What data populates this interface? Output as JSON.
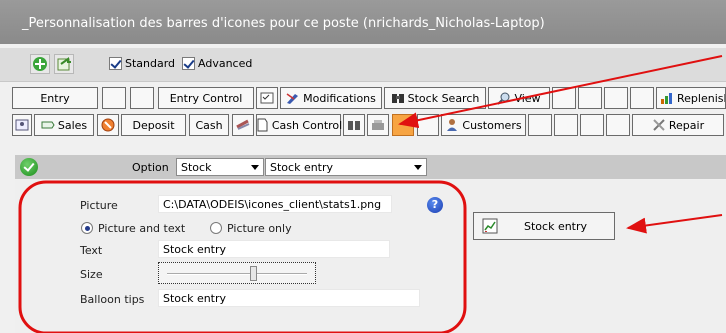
{
  "window": {
    "title": "_Personnalisation des barres d'icones pour ce poste (nrichards_Nicholas-Laptop)"
  },
  "topbar": {
    "checkboxes": [
      {
        "label": "Standard",
        "checked": true
      },
      {
        "label": "Advanced",
        "checked": true
      }
    ]
  },
  "toolbar_row1": {
    "entry": "Entry",
    "entry_control": "Entry Control",
    "modifications": "Modifications",
    "stock_search": "Stock Search",
    "view": "View",
    "replenish": "Replenish"
  },
  "toolbar_row2": {
    "sales": "Sales",
    "deposit": "Deposit",
    "cash": "Cash",
    "cash_control": "Cash Control",
    "customers": "Customers",
    "repair": "Repair"
  },
  "option": {
    "label": "Option",
    "category": "Stock",
    "action": "Stock entry"
  },
  "form": {
    "picture_label": "Picture",
    "picture_value": "C:\\DATA\\ODEIS\\icones_client\\stats1.png",
    "radio_text": "Picture and text",
    "radio_picture": "Picture only",
    "text_label": "Text",
    "text_value": "Stock entry",
    "size_label": "Size",
    "size_level_percent": 62,
    "balloon_label": "Balloon tips",
    "balloon_value": "Stock entry",
    "help_glyph": "?"
  },
  "preview": {
    "label": "Stock entry"
  },
  "colors": {
    "titlebar": "#8f8f8f",
    "highlight_button": "#f7a442",
    "annotation_red": "#e01010",
    "toolbar_border": "#6b6b6b"
  },
  "icons": [
    "add-icon",
    "export-icon",
    "sales-icon",
    "deposit-icon",
    "cash-icon",
    "binoculars-icon",
    "search-icon",
    "customers-icon",
    "repair-icon",
    "chart-icon",
    "help-icon",
    "ok-icon"
  ]
}
